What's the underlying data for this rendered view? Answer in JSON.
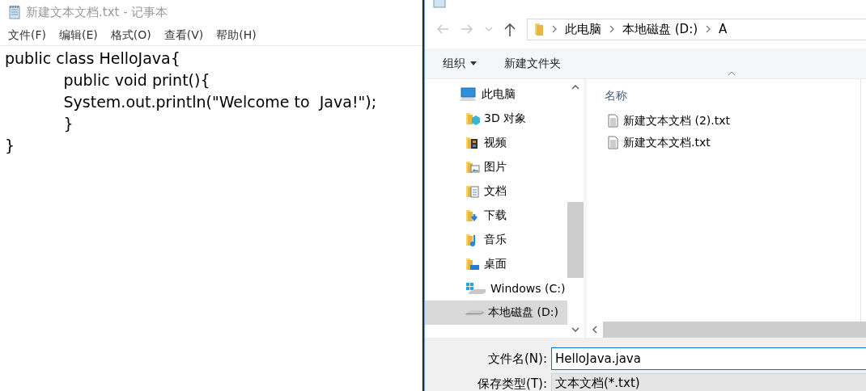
{
  "notepad": {
    "title": "新建文本文档.txt - 记事本",
    "menu": [
      "文件(F)",
      "编辑(E)",
      "格式(O)",
      "查看(V)",
      "帮助(H)"
    ],
    "lines": [
      "public class HelloJava{",
      "\t\tpublic void print(){",
      "\t\tSystem.out.println(\"Welcome to  Java!\");",
      "\t\t}",
      "}"
    ]
  },
  "dialog": {
    "breadcrumbs": [
      "此电脑",
      "本地磁盘 (D:)",
      "A"
    ],
    "toolbar": {
      "organize": "组织",
      "new_folder": "新建文件夹"
    },
    "nav_items": [
      {
        "label": "此电脑",
        "kind": "pc",
        "selected": false
      },
      {
        "label": "3D 对象",
        "kind": "objects3d",
        "selected": false
      },
      {
        "label": "视频",
        "kind": "video",
        "selected": false
      },
      {
        "label": "图片",
        "kind": "pictures",
        "selected": false
      },
      {
        "label": "文档",
        "kind": "documents",
        "selected": false
      },
      {
        "label": "下载",
        "kind": "downloads",
        "selected": false
      },
      {
        "label": "音乐",
        "kind": "music",
        "selected": false
      },
      {
        "label": "桌面",
        "kind": "desktop",
        "selected": false
      },
      {
        "label": "Windows (C:)",
        "kind": "windrive",
        "selected": false
      },
      {
        "label": "本地磁盘 (D:)",
        "kind": "drive",
        "selected": true
      }
    ],
    "column_header": "名称",
    "files": [
      "新建文本文档 (2).txt",
      "新建文本文档.txt"
    ],
    "filename_label": "文件名(N):",
    "filename_value": "HelloJava.java",
    "filetype_label": "保存类型(T):",
    "filetype_value": "文本文档(*.txt)"
  }
}
